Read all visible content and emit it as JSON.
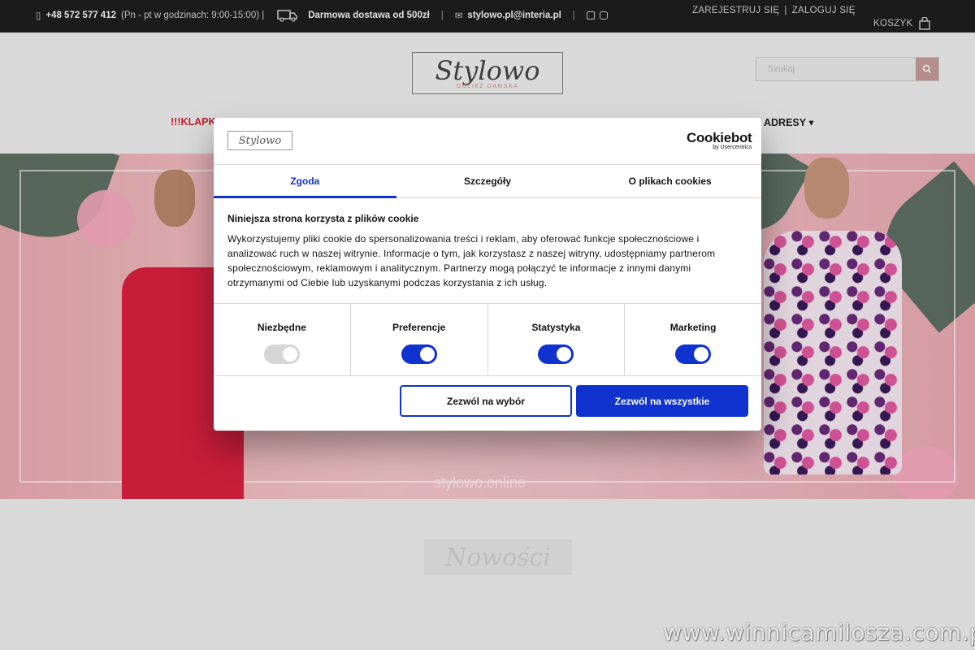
{
  "topbar": {
    "phone": "+48 572 577 412",
    "hours": "(Pn - pt w godzinach: 9:00-15:00) |",
    "shipping": "Darmowa dostawa od 500zł",
    "email": "stylowo.pl@interia.pl",
    "register": "ZAREJESTRUJ SIĘ",
    "login": "ZALOGUJ SIĘ",
    "cart": "KOSZYK"
  },
  "header": {
    "logo_text": "Stylowo",
    "logo_sub": "ODZIEŻ DAMSKA",
    "search_placeholder": "Szukaj",
    "nav_left": "!!!KLAPKI",
    "nav_right": "ADRESY"
  },
  "hero": {
    "caption": "stylowo.online"
  },
  "section": {
    "title": "Nowości"
  },
  "watermark": "www.winnicamilosza.com.pl",
  "cookie": {
    "brand": "Cookiebot",
    "brand_sub": "by Usercentrics",
    "dialog_logo": "Stylowo",
    "tabs": [
      "Zgoda",
      "Szczegóły",
      "O plikach cookies"
    ],
    "heading": "Niniejsza strona korzysta z plików cookie",
    "body": "Wykorzystujemy pliki cookie do spersonalizowania treści i reklam, aby oferować funkcje społecznościowe i analizować ruch w naszej witrynie. Informacje o tym, jak korzystasz z naszej witryny, udostępniamy partnerom społecznościowym, reklamowym i analitycznym. Partnerzy mogą połączyć te informacje z innymi danymi otrzymanymi od Ciebie lub uzyskanymi podczas korzystania z ich usług.",
    "categories": [
      {
        "label": "Niezbędne",
        "on": true,
        "disabled": true
      },
      {
        "label": "Preferencje",
        "on": true
      },
      {
        "label": "Statystyka",
        "on": true
      },
      {
        "label": "Marketing",
        "on": true
      }
    ],
    "btn_selection": "Zezwól na wybór",
    "btn_all": "Zezwól na wszystkie",
    "accent": "#1032cf"
  }
}
